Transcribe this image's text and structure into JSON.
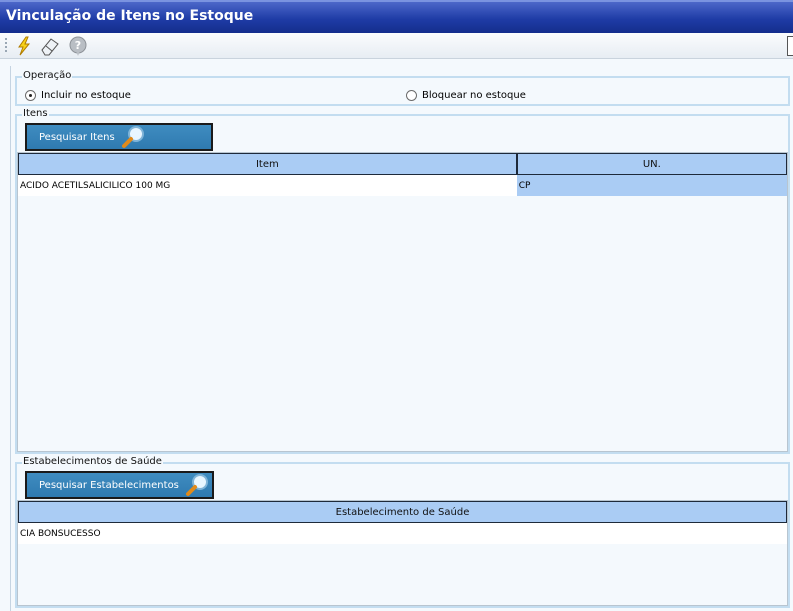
{
  "window": {
    "title": "Vinculação de Itens no Estoque"
  },
  "toolbar": {
    "icons": [
      "lightning-icon",
      "eraser-icon",
      "help-icon"
    ]
  },
  "operacao": {
    "legend": "Operação",
    "options": [
      {
        "label": "Incluir no estoque",
        "selected": true
      },
      {
        "label": "Bloquear no estoque",
        "selected": false
      }
    ]
  },
  "itens": {
    "legend": "Itens",
    "search_button": "Pesquisar Itens",
    "columns": [
      "Item",
      "UN."
    ],
    "rows": [
      {
        "item": "ACIDO ACETILSALICILICO 100 MG",
        "un": "CP"
      }
    ]
  },
  "estabelecimentos": {
    "legend": "Estabelecimentos de Saúde",
    "search_button": "Pesquisar Estabelecimentos",
    "columns": [
      "Estabelecimento de Saúde"
    ],
    "rows": [
      {
        "nome": "CIA BONSUCESSO"
      }
    ]
  }
}
